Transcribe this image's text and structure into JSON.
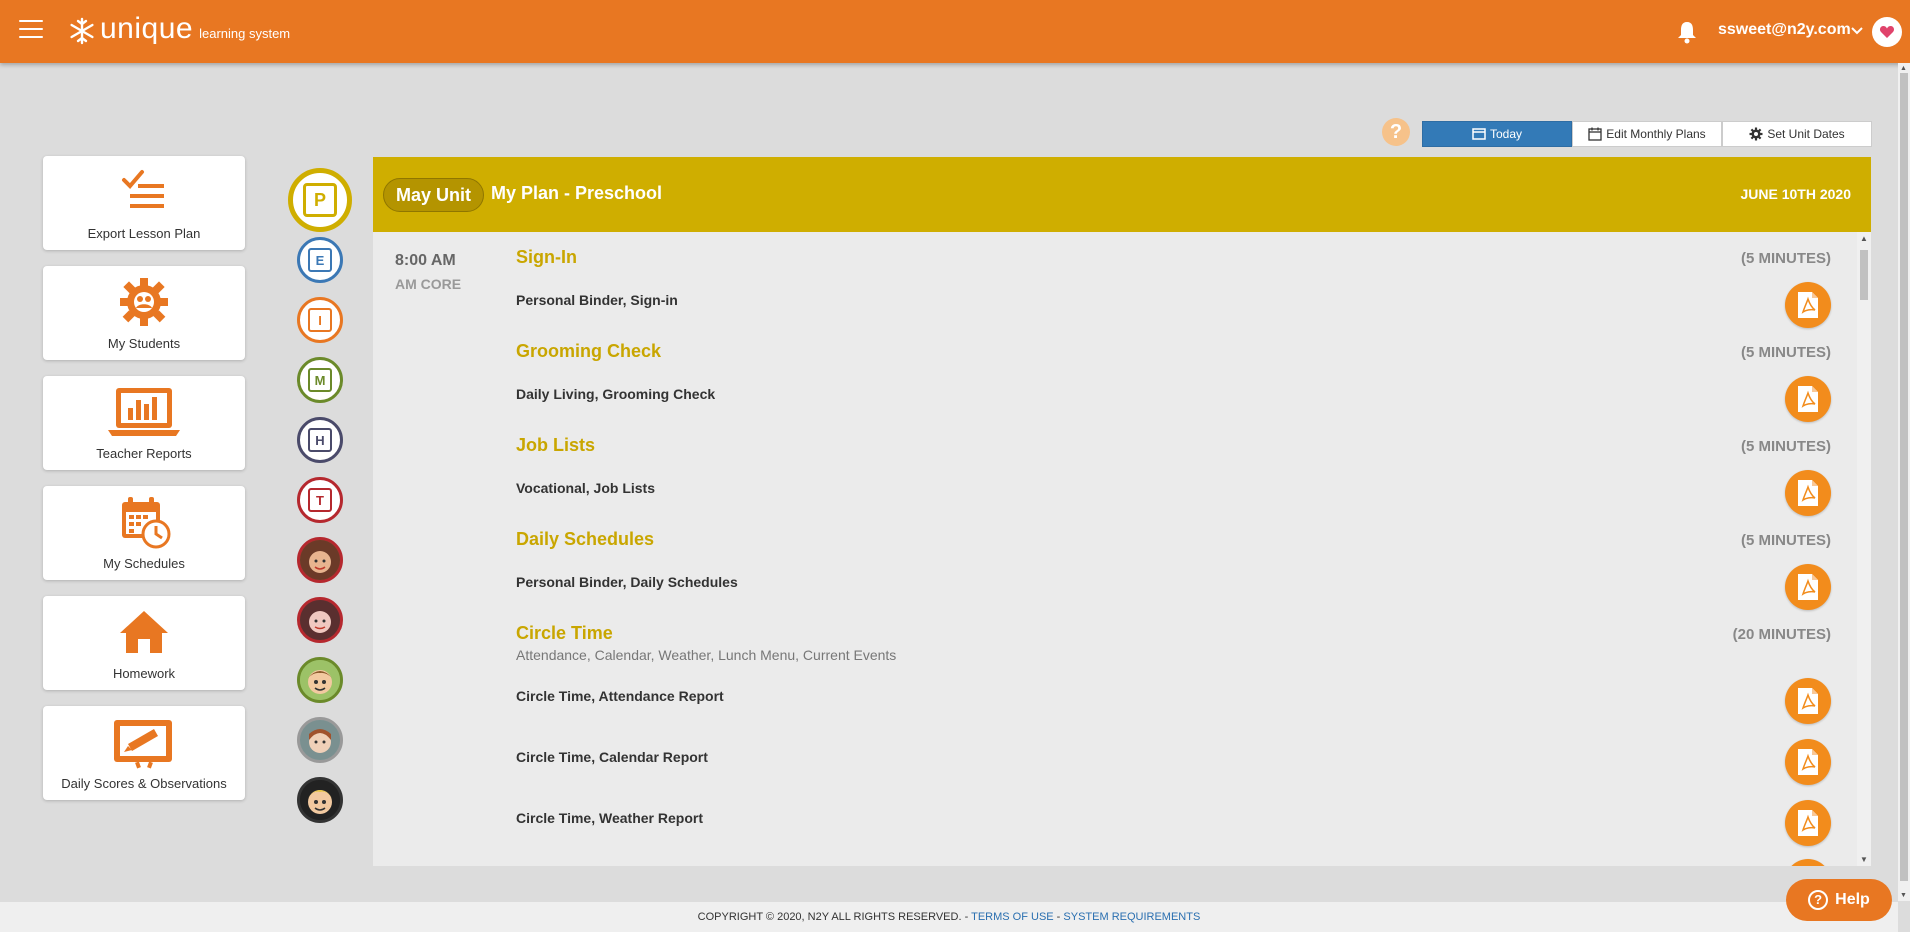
{
  "header": {
    "logo_word": "unique",
    "logo_sub": "learning system",
    "user_email": "ssweet@n2y.com"
  },
  "colors": {
    "brand_orange": "#e87722",
    "plan_gold": "#cfae00",
    "activity_title": "#c9a600",
    "today_blue": "#337ab7",
    "pdf_orange": "#f28c1c"
  },
  "sidebar": {
    "items": [
      {
        "label": "Export Lesson Plan",
        "icon": "checklist-icon"
      },
      {
        "label": "My Students",
        "icon": "gear-students-icon"
      },
      {
        "label": "Teacher Reports",
        "icon": "laptop-chart-icon"
      },
      {
        "label": "My Schedules",
        "icon": "calendar-clock-icon"
      },
      {
        "label": "Homework",
        "icon": "house-icon"
      },
      {
        "label": "Daily Scores & Observations",
        "icon": "clipboard-pencil-icon"
      }
    ]
  },
  "plan_circles": {
    "letters": [
      "P",
      "E",
      "I",
      "M",
      "H",
      "T"
    ]
  },
  "toolbar": {
    "help_mark": "?",
    "today_label": "Today",
    "edit_monthly_label": "Edit Monthly Plans",
    "set_unit_dates_label": "Set Unit Dates"
  },
  "plan": {
    "unit_label": "May Unit",
    "title": "My Plan - Preschool",
    "date": "JUNE 10TH 2020",
    "time": "8:00 AM",
    "block": "AM CORE",
    "activities": [
      {
        "title": "Sign-In",
        "duration": "(5 MINUTES)",
        "items": [
          "Personal Binder, Sign-in"
        ]
      },
      {
        "title": "Grooming Check",
        "duration": "(5 MINUTES)",
        "items": [
          "Daily Living, Grooming Check"
        ]
      },
      {
        "title": "Job Lists",
        "duration": "(5 MINUTES)",
        "items": [
          "Vocational, Job Lists"
        ]
      },
      {
        "title": "Daily Schedules",
        "duration": "(5 MINUTES)",
        "items": [
          "Personal Binder, Daily Schedules"
        ]
      },
      {
        "title": "Circle Time",
        "duration": "(20 MINUTES)",
        "description": "Attendance, Calendar, Weather, Lunch Menu, Current Events",
        "items": [
          "Circle Time, Attendance Report",
          "Circle Time, Calendar Report",
          "Circle Time, Weather Report"
        ]
      }
    ]
  },
  "footer": {
    "copyright": "COPYRIGHT © 2020, N2Y ALL RIGHTS RESERVED. - ",
    "terms": "TERMS OF USE",
    "sep": " - ",
    "requirements": "SYSTEM REQUIREMENTS"
  },
  "help_button": {
    "label": "Help",
    "mark": "?"
  }
}
